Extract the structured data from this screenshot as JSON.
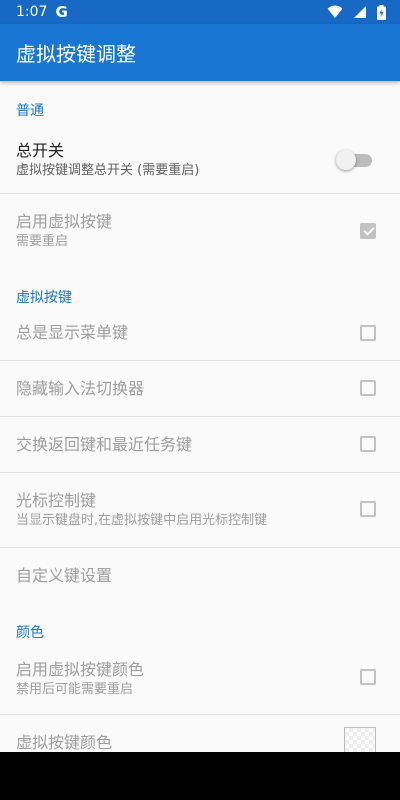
{
  "status_bar": {
    "time": "1:07",
    "app_icon": "google-g-icon",
    "icons": [
      "wifi-icon",
      "signal-icon",
      "battery-charging-icon"
    ]
  },
  "app_bar": {
    "title": "虚拟按键调整"
  },
  "sections": {
    "general": "普通",
    "virtual_keys": "虚拟按键",
    "color": "颜色"
  },
  "prefs": {
    "master_switch": {
      "title": "总开关",
      "summary": "虚拟按键调整总开关 (需要重启)",
      "enabled": false
    },
    "enable_virtual_keys": {
      "title": "启用虚拟按键",
      "summary": "需要重启",
      "checked": true
    },
    "always_show_menu": {
      "title": "总是显示菜单键",
      "checked": false
    },
    "hide_ime_switcher": {
      "title": "隐藏输入法切换器",
      "checked": false
    },
    "swap_back_recent": {
      "title": "交换返回键和最近任务键",
      "checked": false
    },
    "cursor_keys": {
      "title": "光标控制键",
      "summary": "当显示键盘时,在虚拟按键中启用光标控制键",
      "checked": false
    },
    "custom_keys": {
      "title": "自定义键设置"
    },
    "enable_key_color": {
      "title": "启用虚拟按键颜色",
      "summary": "禁用后可能需要重启",
      "checked": false
    },
    "key_color": {
      "title": "虚拟按键颜色"
    }
  },
  "colors": {
    "accent": "#1976d2",
    "status_bar": "#1769c4",
    "nav_bar": "#000000"
  }
}
